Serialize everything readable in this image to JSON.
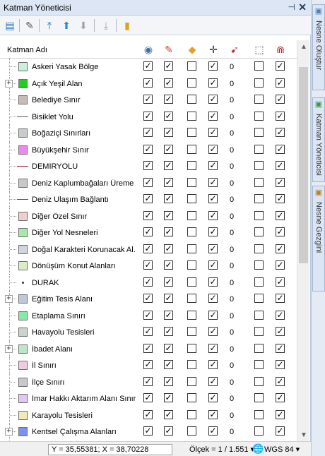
{
  "window": {
    "title": "Katman Yöneticisi",
    "pin_glyph": "⊣",
    "close_glyph": "✕"
  },
  "toolbar": {
    "buttons": [
      {
        "name": "layer-properties-icon",
        "glyph": "▤",
        "color": "#1f6fc4"
      },
      {
        "name": "edit-layer-icon",
        "glyph": "✎",
        "color": "#555"
      },
      {
        "name": "move-top-icon",
        "glyph": "⤒",
        "color": "#1f6fc4"
      },
      {
        "name": "move-up-icon",
        "glyph": "⬆",
        "color": "#2a8ad6"
      },
      {
        "name": "move-down-icon",
        "glyph": "⬇",
        "color": "#9aa4b0"
      },
      {
        "name": "move-bottom-icon",
        "glyph": "⤓",
        "color": "#9aa4b0"
      },
      {
        "name": "layer-settings-icon",
        "glyph": "▮",
        "color": "#e0a020"
      }
    ]
  },
  "header": {
    "name_label": "Katman Adı",
    "icons": [
      {
        "name": "visibility-eye-icon",
        "glyph": "◉",
        "color": "#3a6fb0"
      },
      {
        "name": "editable-pencil-icon",
        "glyph": "✎",
        "color": "#d0402a"
      },
      {
        "name": "label-tag-icon",
        "glyph": "◆",
        "color": "#e8a020"
      },
      {
        "name": "selectable-cursor-icon",
        "glyph": "✛",
        "color": "#333"
      },
      {
        "name": "snap-cursor-icon",
        "glyph": "➹",
        "color": "#c02020"
      },
      {
        "name": "bounds-icon",
        "glyph": "⬚",
        "color": "#333"
      },
      {
        "name": "magnet-icon",
        "glyph": "⋒",
        "color": "#c02020"
      }
    ]
  },
  "layers": [
    {
      "name": "Askeri Yasak Bölge",
      "expandable": false,
      "symbol": "fill",
      "color": "#c8f0dc",
      "checks": [
        true,
        true,
        false,
        true,
        false,
        true
      ],
      "count": "0"
    },
    {
      "name": "Açık Yeşil Alan",
      "expandable": true,
      "symbol": "fill",
      "color": "#22cc22",
      "checks": [
        true,
        true,
        false,
        true,
        false,
        true
      ],
      "count": "0"
    },
    {
      "name": "Belediye Sınır",
      "expandable": false,
      "symbol": "fill",
      "color": "#c8bcb4",
      "checks": [
        true,
        true,
        false,
        true,
        false,
        true
      ],
      "count": "0"
    },
    {
      "name": "Bisiklet Yolu",
      "expandable": false,
      "symbol": "line",
      "color": "#555555",
      "checks": [
        true,
        true,
        false,
        true,
        false,
        true
      ],
      "count": "0"
    },
    {
      "name": "Boğaziçi Sınırları",
      "expandable": false,
      "symbol": "fill",
      "color": "#c8ccd0",
      "checks": [
        true,
        true,
        false,
        true,
        false,
        true
      ],
      "count": "0"
    },
    {
      "name": "Büyükşehir Sınır",
      "expandable": false,
      "symbol": "fill",
      "color": "#ee88ee",
      "checks": [
        true,
        true,
        false,
        true,
        false,
        true
      ],
      "count": "0"
    },
    {
      "name": "DEMIRYOLU",
      "expandable": false,
      "symbol": "line",
      "color": "#8b2020",
      "checks": [
        true,
        true,
        false,
        true,
        false,
        true
      ],
      "count": "0"
    },
    {
      "name": "Deniz Kaplumbağaları Üreme ...",
      "expandable": false,
      "symbol": "fill",
      "color": "#c8c8c8",
      "checks": [
        true,
        true,
        false,
        true,
        false,
        true
      ],
      "count": "0"
    },
    {
      "name": "Deniz Ulaşım Bağlantı",
      "expandable": false,
      "symbol": "line",
      "color": "#555555",
      "checks": [
        true,
        true,
        false,
        true,
        false,
        true
      ],
      "count": "0"
    },
    {
      "name": "Diğer Özel Sınır",
      "expandable": false,
      "symbol": "fill",
      "color": "#eecece",
      "checks": [
        true,
        true,
        false,
        true,
        false,
        true
      ],
      "count": "0"
    },
    {
      "name": "Diğer Yol Nesneleri",
      "expandable": false,
      "symbol": "fill",
      "color": "#a8e8a8",
      "checks": [
        true,
        true,
        false,
        true,
        false,
        true
      ],
      "count": "0"
    },
    {
      "name": "Doğal Karakteri Korunacak Al...",
      "expandable": false,
      "symbol": "fill",
      "color": "#d0d4e0",
      "checks": [
        true,
        true,
        false,
        true,
        false,
        true
      ],
      "count": "0"
    },
    {
      "name": "Dönüşüm Konut Alanları",
      "expandable": false,
      "symbol": "fill",
      "color": "#dcecc8",
      "checks": [
        true,
        true,
        false,
        true,
        false,
        true
      ],
      "count": "0"
    },
    {
      "name": "DURAK",
      "expandable": false,
      "symbol": "point",
      "color": "#333333",
      "checks": [
        true,
        true,
        false,
        true,
        false,
        true
      ],
      "count": "0"
    },
    {
      "name": "Eğitim Tesis Alanı",
      "expandable": true,
      "symbol": "fill",
      "color": "#c0c8d8",
      "checks": [
        true,
        true,
        false,
        true,
        false,
        true
      ],
      "count": "0"
    },
    {
      "name": "Etaplama Sınırı",
      "expandable": false,
      "symbol": "fill",
      "color": "#88e8a8",
      "checks": [
        true,
        true,
        false,
        true,
        false,
        true
      ],
      "count": "0"
    },
    {
      "name": "Havayolu Tesisleri",
      "expandable": false,
      "symbol": "fill",
      "color": "#c8d4cc",
      "checks": [
        true,
        true,
        false,
        true,
        false,
        true
      ],
      "count": "0"
    },
    {
      "name": "İbadet Alanı",
      "expandable": true,
      "symbol": "fill",
      "color": "#b8e8c8",
      "checks": [
        true,
        true,
        false,
        true,
        false,
        true
      ],
      "count": "0"
    },
    {
      "name": "İl Sınırı",
      "expandable": false,
      "symbol": "fill",
      "color": "#eecce0",
      "checks": [
        true,
        true,
        false,
        true,
        false,
        true
      ],
      "count": "0"
    },
    {
      "name": "İlçe Sınırı",
      "expandable": false,
      "symbol": "fill",
      "color": "#c8c8cc",
      "checks": [
        true,
        true,
        false,
        true,
        false,
        true
      ],
      "count": "0"
    },
    {
      "name": "İmar Hakkı Aktarım Alanı Sınırı",
      "expandable": false,
      "symbol": "fill",
      "color": "#e0c8f0",
      "checks": [
        true,
        true,
        false,
        true,
        false,
        true
      ],
      "count": "0"
    },
    {
      "name": "Karayolu Tesisleri",
      "expandable": false,
      "symbol": "fill",
      "color": "#f0eab8",
      "checks": [
        true,
        true,
        false,
        true,
        false,
        true
      ],
      "count": "0"
    },
    {
      "name": "Kentsel Çalışma Alanları",
      "expandable": true,
      "symbol": "fill",
      "color": "#8090f0",
      "checks": [
        true,
        true,
        false,
        true,
        false,
        true
      ],
      "count": "0"
    }
  ],
  "status": {
    "coords": "Y = 35,55381; X = 38,70228",
    "scale": "Ölçek = 1 / 1.551 ▾",
    "crs": "WGS 84 ▾"
  },
  "side_tabs": [
    {
      "label": "Nesne Oluştur",
      "icon_color": "#4a80c0"
    },
    {
      "label": "Katman Yöneticisi",
      "icon_color": "#3a9a4a"
    },
    {
      "label": "Nesne Gezgini",
      "icon_color": "#c08020"
    }
  ]
}
